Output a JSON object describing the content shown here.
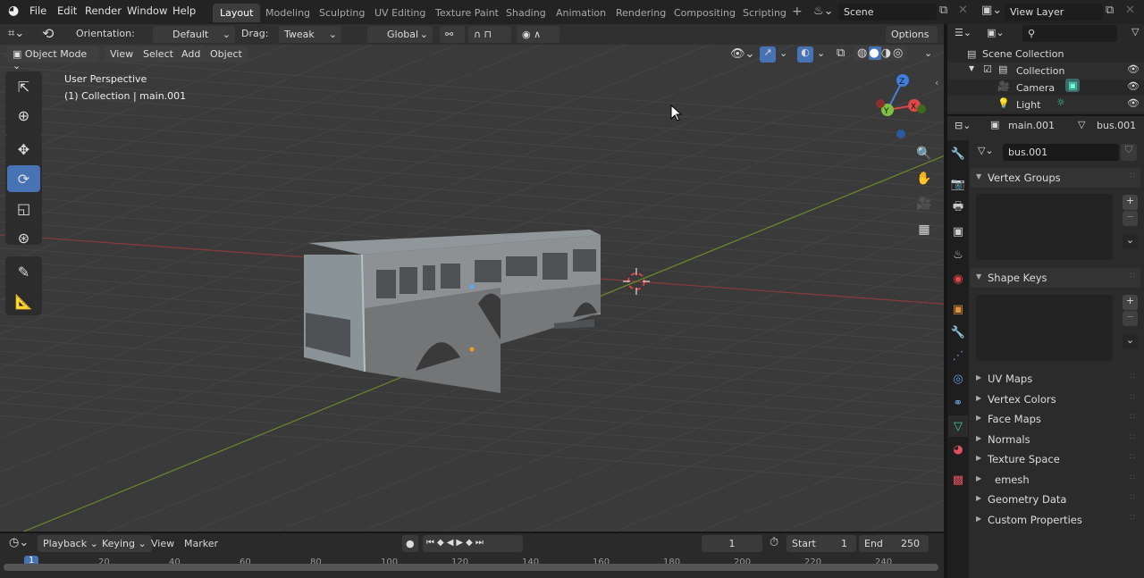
{
  "menu": [
    "File",
    "Edit",
    "Render",
    "Window",
    "Help"
  ],
  "workspaces": [
    {
      "label": "Layout",
      "active": true
    },
    {
      "label": "Modeling"
    },
    {
      "label": "Sculpting"
    },
    {
      "label": "UV Editing"
    },
    {
      "label": "Texture Paint"
    },
    {
      "label": "Shading"
    },
    {
      "label": "Animation"
    },
    {
      "label": "Rendering"
    },
    {
      "label": "Compositing"
    },
    {
      "label": "Scripting"
    }
  ],
  "add_workspace": "+",
  "scene": "Scene",
  "view_layer": "View Layer",
  "tool_header": {
    "orientation_label": "Orientation:",
    "orientation": "Default",
    "drag_label": "Drag:",
    "drag": "Tweak",
    "transform": "Global",
    "options": "Options"
  },
  "viewport_header": {
    "mode": "Object Mode",
    "menus": [
      "View",
      "Select",
      "Add",
      "Object"
    ]
  },
  "viewport": {
    "perspective": "User Perspective",
    "context": "(1) Collection | main.001",
    "axis_x": "X",
    "axis_y": "Y",
    "axis_z": "Z",
    "colors": {
      "x_axis": "#8a3a3a",
      "y_axis": "#6a8a2a",
      "bg": "#3a3a3a"
    }
  },
  "outliner": {
    "root": "Scene Collection",
    "items": [
      {
        "label": "Collection"
      },
      {
        "label": "Camera"
      },
      {
        "label": "Light"
      }
    ]
  },
  "properties": {
    "object": "main.001",
    "mesh": "bus.001",
    "mesh_field": "bus.001",
    "panels": [
      {
        "label": "Vertex Groups",
        "open": true
      },
      {
        "label": "Shape Keys",
        "open": true
      },
      {
        "label": "UV Maps"
      },
      {
        "label": "Vertex Colors"
      },
      {
        "label": "Face Maps"
      },
      {
        "label": "Normals"
      },
      {
        "label": "Texture Space"
      },
      {
        "label": "emesh"
      },
      {
        "label": "Geometry Data"
      },
      {
        "label": "Custom Properties"
      }
    ]
  },
  "timeline": {
    "menus": [
      "Playback",
      "Keying",
      "View",
      "Marker"
    ],
    "current_frame": "1",
    "start_label": "Start",
    "start": "1",
    "end_label": "End",
    "end": "250",
    "ticks": [
      "1",
      "20",
      "40",
      "60",
      "80",
      "100",
      "120",
      "140",
      "160",
      "180",
      "200",
      "220",
      "240"
    ]
  },
  "accent": "#4772b3"
}
